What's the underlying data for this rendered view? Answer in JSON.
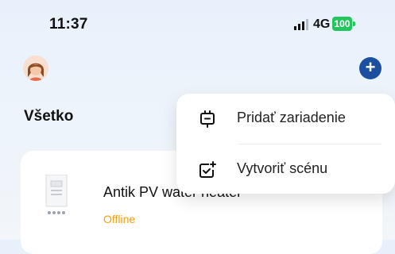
{
  "status_bar": {
    "time": "11:37",
    "network": "4G",
    "battery": "100"
  },
  "header": {
    "avatar_icon": "avatar-icon",
    "add_icon": "plus-icon"
  },
  "tabs": {
    "all": "Všetko"
  },
  "menu": {
    "items": [
      {
        "label": "Pridať zariadenie",
        "icon": "plug-icon"
      },
      {
        "label": "Vytvoriť scénu",
        "icon": "scene-add-icon"
      }
    ]
  },
  "device": {
    "name": "Antik PV water heater",
    "status": "Offline"
  },
  "colors": {
    "accent": "#1d4fa0",
    "offline": "#f59e0b",
    "battery": "#22c55e"
  }
}
